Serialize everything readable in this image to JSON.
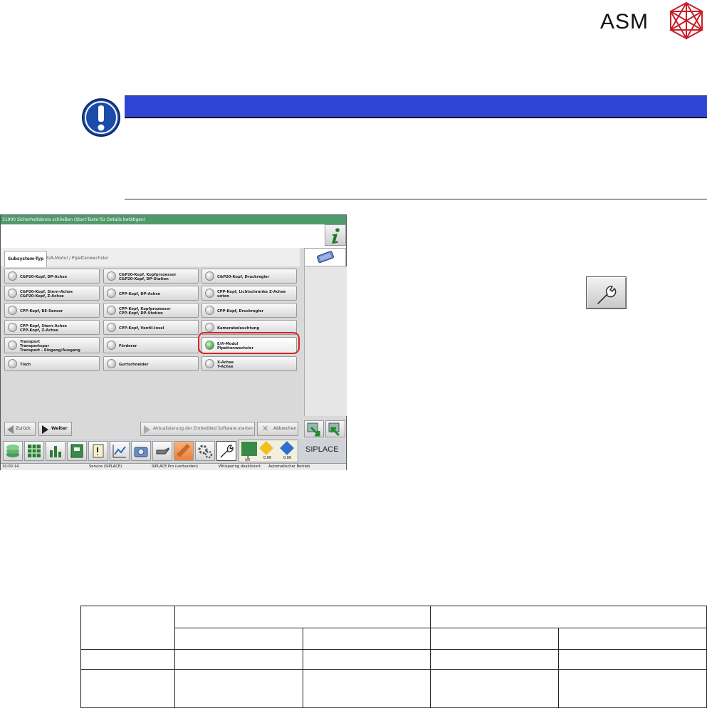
{
  "logo": {
    "text": "ASM"
  },
  "screen": {
    "message": "31900 Sicherheitskreis schließen (Start-Taste für Details betätigen)",
    "tabs": [
      "Subsystem-Typ",
      "E/A-Modul / Pipettenwechsler"
    ],
    "selected_tab": "Subsystem-Typ",
    "grid": [
      [
        [
          "C&P20-Kopf, DP-Achse"
        ],
        [
          "C&P20-Kopf, Kopfprozessor",
          "C&P20-Kopf, DP-Station"
        ],
        [
          "C&P20-Kopf, Druckregler"
        ]
      ],
      [
        [
          "C&P20-Kopf, Stern-Achse",
          "C&P20-Kopf, Z-Achse"
        ],
        [
          "CPP-Kopf, DP-Achse"
        ],
        [
          "CPP-Kopf, Lichtschranke Z-Achse unten"
        ]
      ],
      [
        [
          "CPP-Kopf, BE-Sensor"
        ],
        [
          "CPP-Kopf, Kopfprozessor",
          "CPP-Kopf, DP-Station"
        ],
        [
          "CPP-Kopf, Druckregler"
        ]
      ],
      [
        [
          "CPP-Kopf, Stern-Achse",
          "CPP-Kopf, Z-Achse"
        ],
        [
          "CPP-Kopf, Ventil-Insel"
        ],
        [
          "Kamerabeleuchtung"
        ]
      ],
      [
        [
          "Transport",
          "Transportspur",
          "Transport - Eingang/Ausgang"
        ],
        [
          "Förderer"
        ],
        [
          "E/A-Modul",
          "Pipettenwechsler"
        ]
      ],
      [
        [
          "Tisch"
        ],
        [
          "Gurtschneider"
        ],
        [
          "X-Achse",
          "Y-Achse"
        ]
      ]
    ],
    "selected_item": "E/A-Modul / Pipettenwechsler",
    "buttons": {
      "back": "Zurück",
      "next": "Weiter",
      "update": "Aktualisierung der Embedded Software starten",
      "cancel": "Abbrechen"
    },
    "counters": {
      "c1": "0",
      "c1b": "0/0",
      "c2": "0.00",
      "c3": "0.00"
    },
    "brand": "SIPLACE",
    "status": {
      "time": "10:00:14",
      "mode": "Service (SIPLACE)",
      "connection": "SIPLACE Pro (verbunden)",
      "whisper": "Whispering deaktiviert",
      "operation": "Automatischer Betrieb"
    }
  },
  "colors": {
    "warning_bar": "#2e45d8",
    "accent_green": "#4f9a6a",
    "highlight": "#d2232a"
  }
}
